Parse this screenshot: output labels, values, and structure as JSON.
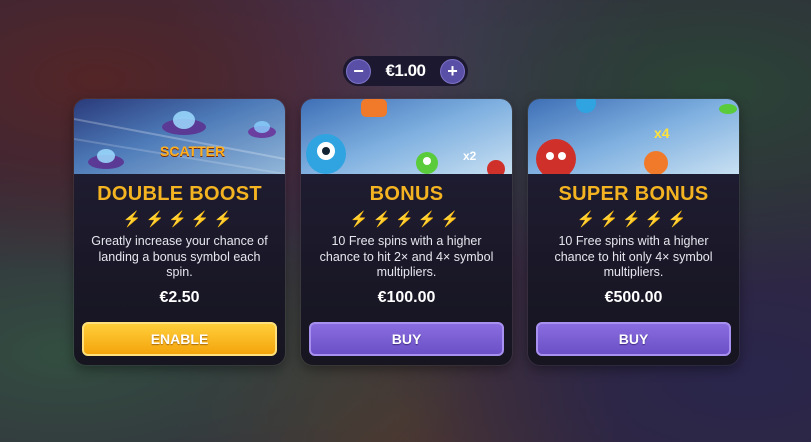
{
  "bet": {
    "decrease_icon": "minus-icon",
    "increase_icon": "plus-icon",
    "decrease_label": "−",
    "increase_label": "+",
    "value": "€1.00"
  },
  "cards": [
    {
      "art_text": "SCATTER",
      "title": "DOUBLE BOOST",
      "bolts": "⚡⚡⚡⚡⚡",
      "description": "Greatly increase your chance of landing a bonus symbol each spin.",
      "price": "€2.50",
      "button": "ENABLE",
      "button_color": "#f4a40c"
    },
    {
      "art_text": "x2",
      "title": "BONUS",
      "bolts": "⚡⚡⚡⚡⚡",
      "description": "10 Free spins with a higher chance to hit 2× and 4× symbol multipliers.",
      "price": "€100.00",
      "button": "BUY",
      "button_color": "#6a4fc6"
    },
    {
      "art_text": "x4",
      "title": "SUPER BONUS",
      "bolts": "⚡⚡⚡⚡⚡",
      "description": "10 Free spins with a higher chance to hit only 4× symbol multipliers.",
      "price": "€500.00",
      "button": "BUY",
      "button_color": "#6a4fc6"
    }
  ],
  "colors": {
    "title": "#f4b320",
    "bolt": "#f6c83a"
  }
}
